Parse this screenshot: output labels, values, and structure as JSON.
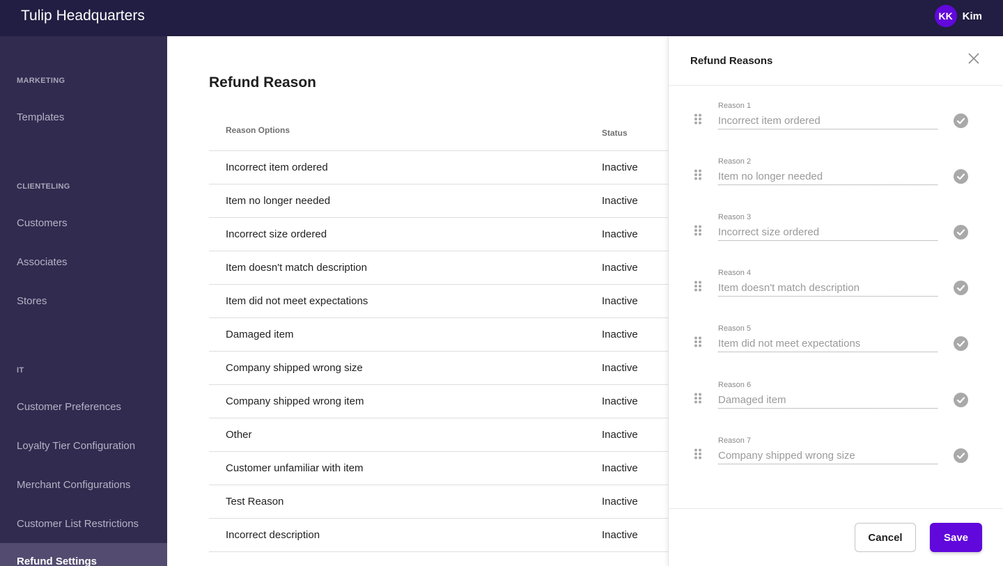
{
  "topbar": {
    "app_title": "Tulip Headquarters",
    "user": {
      "initials": "KK",
      "name": "Kim",
      "avatar_color": "#6108dc"
    }
  },
  "sidebar": {
    "sections": [
      {
        "label": "MARKETING",
        "items": [
          {
            "label": "Templates"
          }
        ]
      },
      {
        "label": "CLIENTELING",
        "items": [
          {
            "label": "Customers"
          },
          {
            "label": "Associates"
          },
          {
            "label": "Stores"
          }
        ]
      },
      {
        "label": "IT",
        "items": [
          {
            "label": "Customer Preferences"
          },
          {
            "label": "Loyalty Tier Configuration"
          },
          {
            "label": "Merchant Configurations"
          },
          {
            "label": "Customer List Restrictions"
          },
          {
            "label": "Refund Settings",
            "active": true
          }
        ]
      }
    ]
  },
  "main": {
    "title": "Refund Reason",
    "table": {
      "headers": {
        "reason": "Reason Options",
        "status": "Status"
      },
      "rows": [
        {
          "reason": "Incorrect item ordered",
          "status": "Inactive"
        },
        {
          "reason": "Item no longer needed",
          "status": "Inactive"
        },
        {
          "reason": "Incorrect size ordered",
          "status": "Inactive"
        },
        {
          "reason": "Item doesn't match description",
          "status": "Inactive"
        },
        {
          "reason": "Item did not meet expectations",
          "status": "Inactive"
        },
        {
          "reason": "Damaged item",
          "status": "Inactive"
        },
        {
          "reason": "Company shipped wrong size",
          "status": "Inactive"
        },
        {
          "reason": "Company shipped wrong item",
          "status": "Inactive"
        },
        {
          "reason": "Other",
          "status": "Inactive"
        },
        {
          "reason": "Customer unfamiliar with item",
          "status": "Inactive"
        },
        {
          "reason": "Test Reason",
          "status": "Inactive"
        },
        {
          "reason": "Incorrect description",
          "status": "Inactive"
        }
      ]
    }
  },
  "drawer": {
    "title": "Refund Reasons",
    "close_icon": "close-icon",
    "reasons": [
      {
        "label": "Reason 1",
        "value": "Incorrect item ordered"
      },
      {
        "label": "Reason 2",
        "value": "Item no longer needed"
      },
      {
        "label": "Reason 3",
        "value": "Incorrect size ordered"
      },
      {
        "label": "Reason 4",
        "value": "Item doesn't match description"
      },
      {
        "label": "Reason 5",
        "value": "Item did not meet expectations"
      },
      {
        "label": "Reason 6",
        "value": "Damaged item"
      },
      {
        "label": "Reason 7",
        "value": "Company shipped wrong size"
      }
    ],
    "cancel_label": "Cancel",
    "save_label": "Save",
    "accent_color": "#6108dc"
  }
}
